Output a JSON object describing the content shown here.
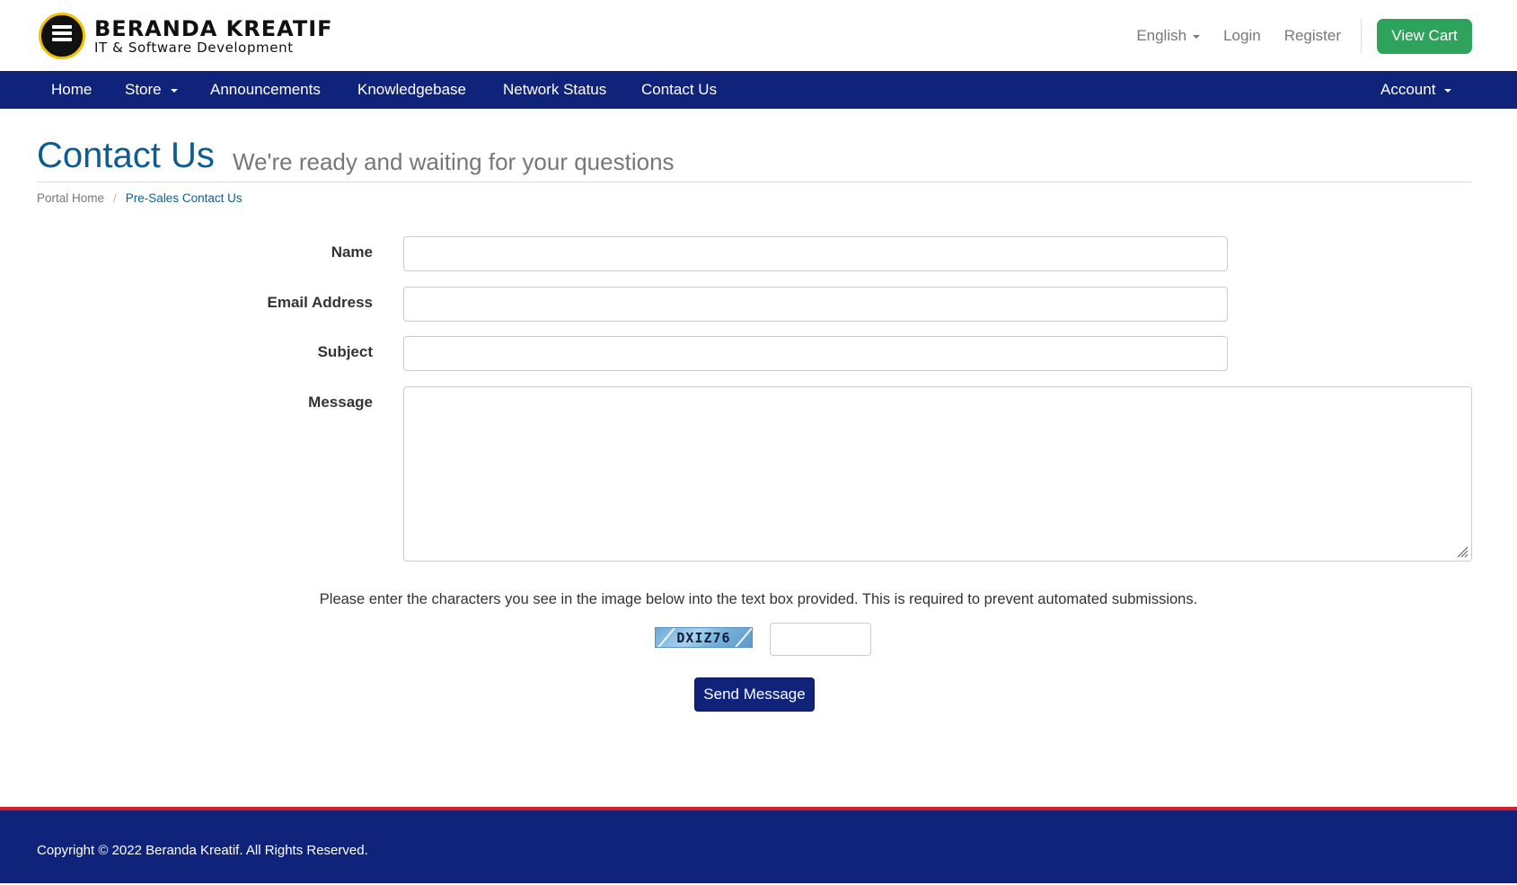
{
  "brand": {
    "title": "BERANDA KREATIF",
    "subtitle": "IT & Software Development",
    "badge_text": "BERANDA KREATIF"
  },
  "top_links": {
    "language": "English",
    "login": "Login",
    "register": "Register",
    "view_cart": "View Cart"
  },
  "nav": {
    "items": [
      {
        "label": "Home"
      },
      {
        "label": "Store",
        "dropdown": true
      },
      {
        "label": "Announcements"
      },
      {
        "label": "Knowledgebase"
      },
      {
        "label": "Network Status"
      },
      {
        "label": "Contact Us"
      }
    ],
    "account": "Account"
  },
  "page": {
    "title": "Contact Us",
    "subtitle": "We're ready and waiting for your questions"
  },
  "breadcrumb": {
    "home": "Portal Home",
    "separator": "/",
    "current": "Pre-Sales Contact Us"
  },
  "form": {
    "name_label": "Name",
    "name_value": "",
    "email_label": "Email Address",
    "email_value": "",
    "subject_label": "Subject",
    "subject_value": "",
    "message_label": "Message",
    "message_value": "",
    "captcha_note": "Please enter the characters you see in the image below into the text box provided. This is required to prevent automated submissions.",
    "captcha_code": "DXIZ76",
    "captcha_value": "",
    "submit": "Send Message"
  },
  "footer": {
    "copyright": "Copyright © 2022 Beranda Kreatif. All Rights Reserved."
  },
  "colors": {
    "nav_bg": "#10237a",
    "accent_title": "#0f5d8e",
    "cart_button": "#2ea35b",
    "footer_border": "#d0202a"
  }
}
